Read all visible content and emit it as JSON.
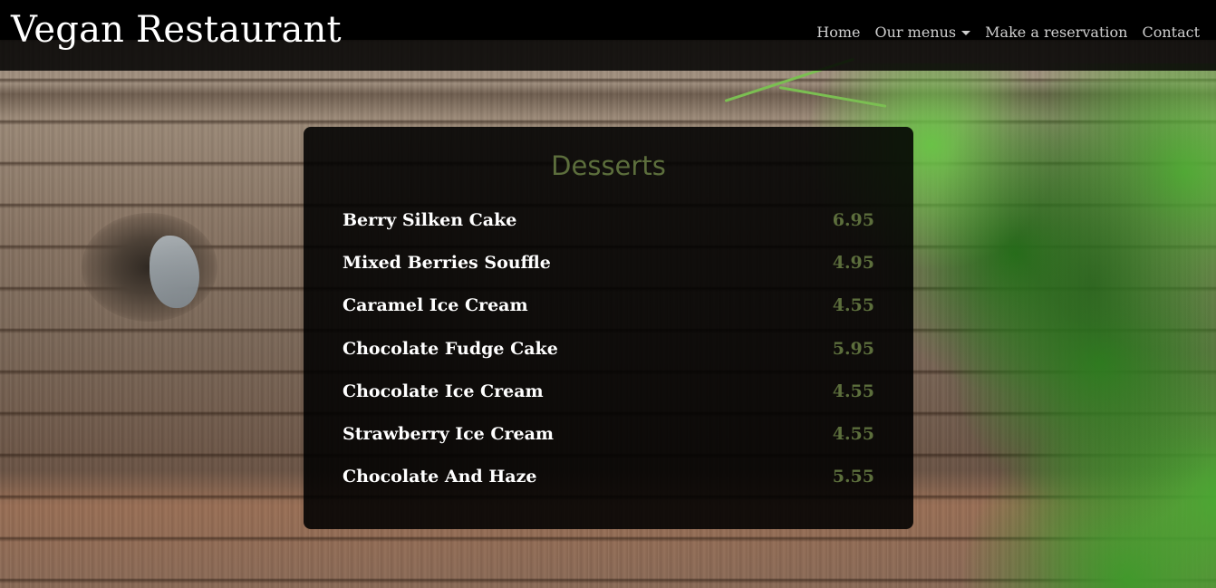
{
  "navbar": {
    "brand": "Vegan Restaurant",
    "links": [
      {
        "label": "Home"
      },
      {
        "label": "Our menus"
      },
      {
        "label": "Make a reservation"
      },
      {
        "label": "Contact"
      }
    ]
  },
  "menu": {
    "title": "Desserts",
    "items": [
      {
        "name": "Berry Silken Cake",
        "price": "6.95"
      },
      {
        "name": "Mixed Berries Souffle",
        "price": "4.95"
      },
      {
        "name": "Caramel Ice Cream",
        "price": "4.55"
      },
      {
        "name": "Chocolate Fudge Cake",
        "price": "5.95"
      },
      {
        "name": "Chocolate Ice Cream",
        "price": "4.55"
      },
      {
        "name": "Strawberry Ice Cream",
        "price": "4.55"
      },
      {
        "name": "Chocolate And Haze",
        "price": "5.55"
      }
    ]
  },
  "colors": {
    "accent": "#5c6e3c",
    "nav_text": "#cfcfcf",
    "card_bg": "#000000"
  },
  "icons": {
    "dropdown": "caret-down-icon"
  }
}
